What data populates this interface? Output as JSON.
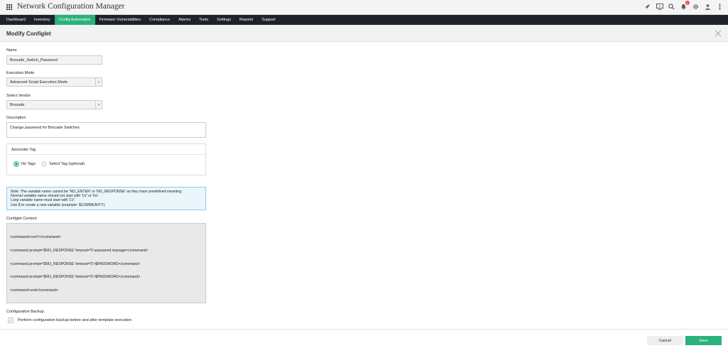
{
  "app": {
    "title": "Network Configuration Manager",
    "notifications_count": "2"
  },
  "nav": [
    {
      "label": "Dashboard",
      "active": false
    },
    {
      "label": "Inventory",
      "active": false
    },
    {
      "label": "Config Automation",
      "active": true
    },
    {
      "label": "Firmware Vulnerabilities",
      "active": false
    },
    {
      "label": "Compliance",
      "active": false
    },
    {
      "label": "Alarms",
      "active": false
    },
    {
      "label": "Tools",
      "active": false
    },
    {
      "label": "Settings",
      "active": false
    },
    {
      "label": "Reports",
      "active": false
    },
    {
      "label": "Support",
      "active": false
    }
  ],
  "top_icons": [
    "rocket-icon",
    "monitor-icon",
    "search-icon",
    "bell-icon",
    "gear-icon",
    "user-icon",
    "more-vertical-icon"
  ],
  "page": {
    "title": "Modify Configlet"
  },
  "form": {
    "name_label": "Name",
    "name_value": "Brocade_Switch_Password",
    "exec_label": "Execution Mode",
    "exec_value": "Advanced Script Execution Mode",
    "vendor_label": "Select Vendor",
    "vendor_value": "Brocade",
    "desc_label": "Description",
    "desc_value": "Change password for Brocade Switches",
    "tag_header": "Associate Tag",
    "tag_no": "No Tags",
    "tag_select": "Select Tag (optional)",
    "note_lines": [
      "Note :The variable name cannot be 'NO_ENTER' or 'NO_RESPONSE' as they have predefined meaning.",
      "Normal variable name should not start with 'LV' or 'for'.",
      "Loop variable name must start with 'LV'.",
      "Use $ to create a new variable (example: $COMMUNITY)."
    ],
    "content_label": "Configlet Content",
    "content_lines": [
      "<command>conf t</command>",
      "<command prompt='$NO_RESPONSE' timeout='5'>password manager</command>",
      "<command prompt='$NO_RESPONSE' timeout='5'>$PASSWORD</command>",
      "<command prompt='$NO_RESPONSE' timeout='5'>$PASSWORD</command>",
      "<command>end</command>"
    ],
    "backup_label": "Configuration Backup",
    "backup_check": "Perform configuration backup before and after template execution"
  },
  "footer": {
    "cancel": "Cancel",
    "save": "Save"
  },
  "colors": {
    "accent": "#2ab27b",
    "nav_bg": "#1f2327",
    "note_border": "#8ccbe6"
  }
}
